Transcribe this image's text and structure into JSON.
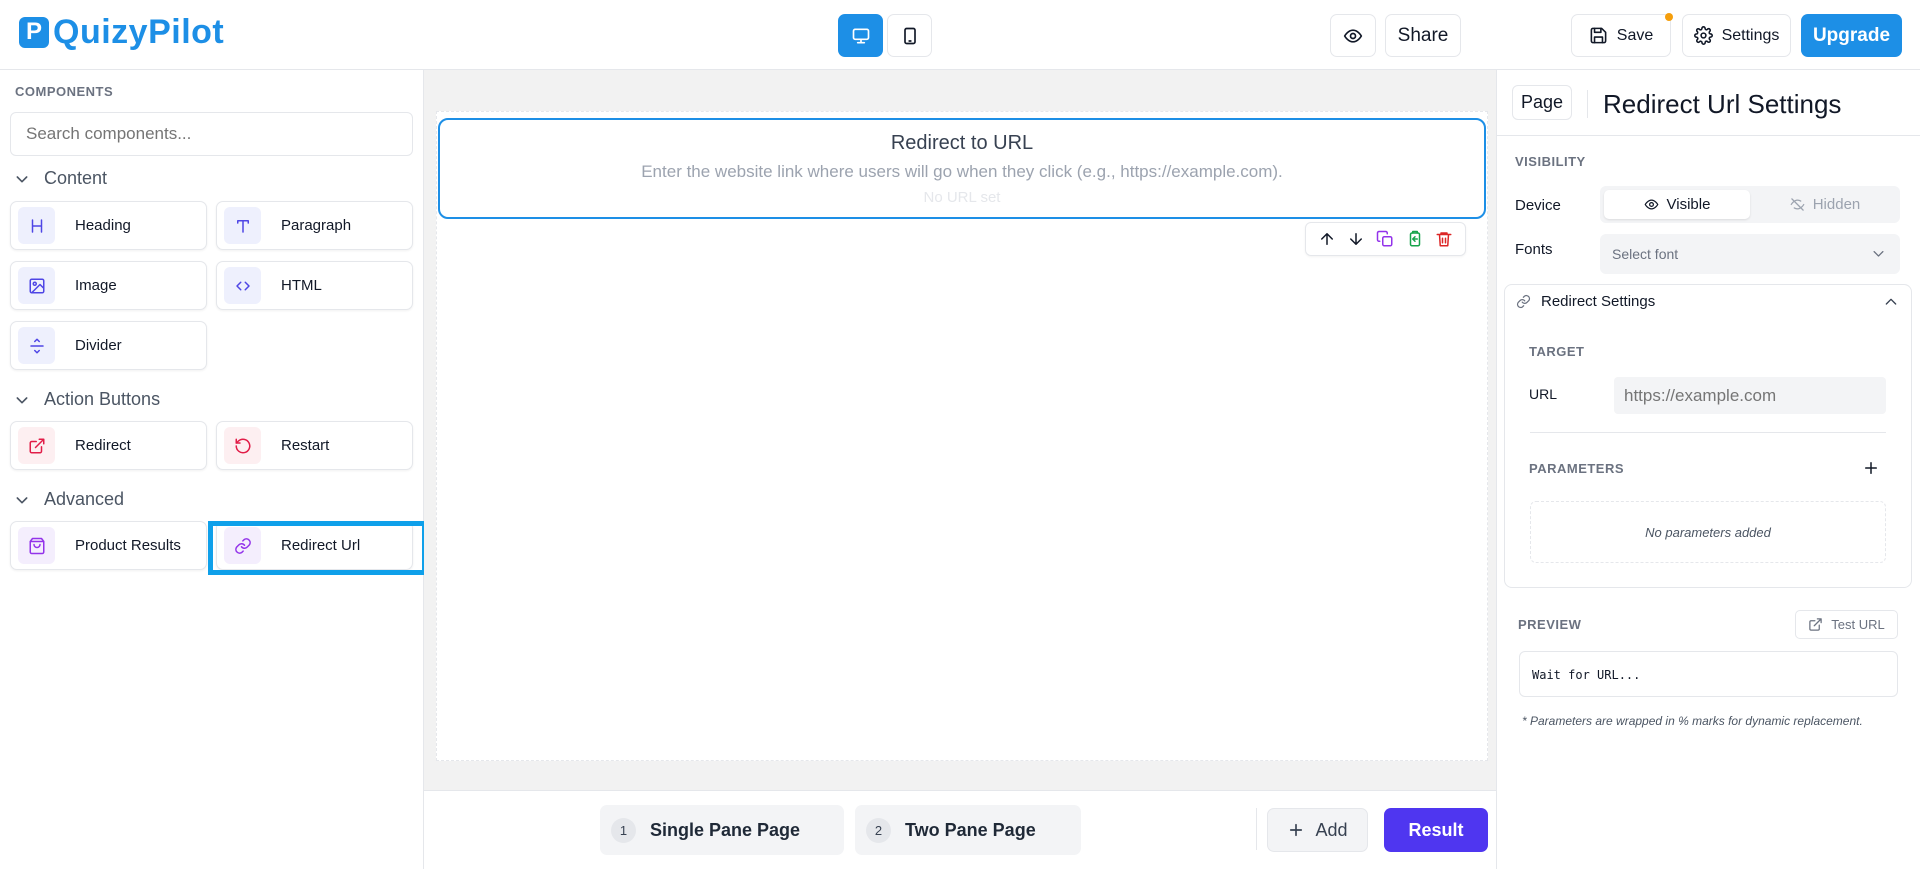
{
  "app": {
    "logo_letter": "P",
    "name": "QuizyPilot"
  },
  "header": {
    "share_label": "Share",
    "save_label": "Save",
    "settings_label": "Settings",
    "upgrade_label": "Upgrade"
  },
  "sidebar": {
    "title": "COMPONENTS",
    "search_placeholder": "Search components...",
    "sections": {
      "content": "Content",
      "action": "Action Buttons",
      "advanced": "Advanced"
    },
    "items": {
      "heading": "Heading",
      "paragraph": "Paragraph",
      "image": "Image",
      "html": "HTML",
      "divider": "Divider",
      "redirect": "Redirect",
      "restart": "Restart",
      "product_results": "Product Results",
      "redirect_url": "Redirect Url"
    }
  },
  "canvas": {
    "block_title": "Redirect to URL",
    "block_subtitle": "Enter the website link where users will go when they click (e.g., https://example.com).",
    "block_status": "No URL set"
  },
  "pages": {
    "tabs": [
      {
        "num": "1",
        "label": "Single Pane Page"
      },
      {
        "num": "2",
        "label": "Two Pane Page"
      }
    ],
    "add_label": "Add",
    "result_label": "Result"
  },
  "settings_panel": {
    "page_label": "Page",
    "title": "Redirect Url Settings",
    "visibility_caption": "VISIBILITY",
    "device_label": "Device",
    "visible_label": "Visible",
    "hidden_label": "Hidden",
    "fonts_label": "Fonts",
    "font_placeholder": "Select font",
    "redirect_settings_label": "Redirect Settings",
    "target_caption": "TARGET",
    "url_label": "URL",
    "url_placeholder": "https://example.com",
    "parameters_caption": "PARAMETERS",
    "no_params": "No parameters added",
    "preview_caption": "PREVIEW",
    "test_url_label": "Test URL",
    "preview_text": "Wait for URL...",
    "footnote": "* Parameters are wrapped in % marks for dynamic replacement."
  },
  "colors": {
    "brand": "#1d8fe6",
    "result": "#4f36f0",
    "highlight": "#0fa0ea",
    "save_dot": "#f59e0b"
  }
}
